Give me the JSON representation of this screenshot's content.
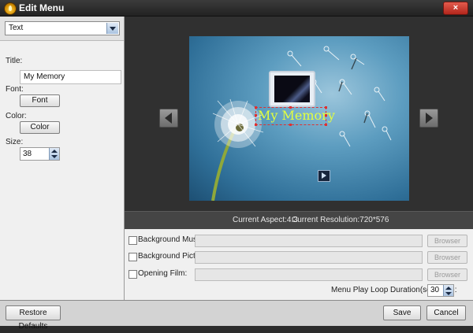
{
  "window": {
    "title": "Edit Menu",
    "close_label": "×"
  },
  "left_panel": {
    "dropdown_value": "Text",
    "title_label": "Title:",
    "title_value": "My Memory",
    "font_label": "Font:",
    "font_button": "Font",
    "color_label": "Color:",
    "color_button": "Color",
    "size_label": "Size:",
    "size_value": "38"
  },
  "preview": {
    "menu_title": "My Memory",
    "title_color": "#e3ff3e"
  },
  "info": {
    "aspect": "Current Aspect:4:3",
    "resolution": "Current Resolution:720*576"
  },
  "options": {
    "background_music_label": "Background Music:",
    "background_picture_label": "Background Picture:",
    "opening_film_label": "Opening Film:",
    "browser_label": "Browser",
    "loop_label": "Menu Play Loop Duration(seconds):",
    "loop_value": "30"
  },
  "footer": {
    "restore_label": "Restore Defaults",
    "save_label": "Save",
    "cancel_label": "Cancel"
  },
  "icons": {
    "app": "app-flame-icon",
    "prev": "arrow-left-icon",
    "next": "arrow-right-icon",
    "play": "play-icon"
  }
}
